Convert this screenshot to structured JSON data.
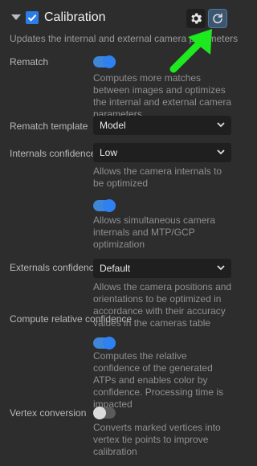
{
  "header": {
    "title": "Calibration",
    "enabled": true,
    "settings_icon": "gear-icon",
    "refresh_icon": "refresh-icon",
    "description": "Updates the internal and external camera parameters"
  },
  "rows": {
    "rematch": {
      "label": "Rematch",
      "toggle_on": true,
      "description": "Computes more matches between images and optimizes the internal and external camera parameters"
    },
    "rematch_template": {
      "label": "Rematch template",
      "value": "Model"
    },
    "internals_confidence": {
      "label": "Internals confidence",
      "value": "Low",
      "description": "Allows the camera internals to be optimized"
    },
    "simultaneous": {
      "toggle_on": true,
      "description": "Allows simultaneous camera internals and MTP/GCP optimization"
    },
    "externals_confidence": {
      "label": "Externals confidence",
      "value": "Default",
      "description": "Allows the camera positions and orientations to be optimized in accordance with their accuracy values in the cameras table"
    },
    "compute_relative_confidence": {
      "label": "Compute relative confidence",
      "toggle_on": true,
      "description": "Computes the relative confidence of the generated ATPs and enables color by confidence. Processing time is impacted"
    },
    "vertex_conversion": {
      "label": "Vertex conversion",
      "toggle_on": false,
      "description": "Converts marked vertices into vertex tie points to improve calibration"
    }
  },
  "colors": {
    "accent": "#2f80f0",
    "annotation_arrow": "#1ee81e",
    "background": "#2d2d2d"
  }
}
